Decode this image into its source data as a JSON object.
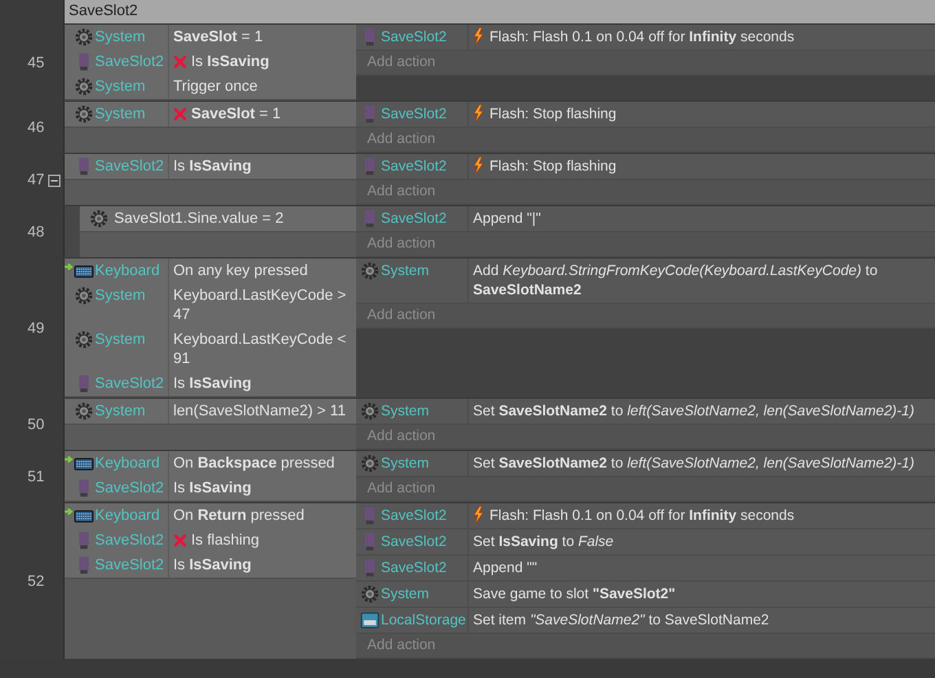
{
  "group": {
    "title": "SaveSlot2"
  },
  "events": [
    {
      "line": "45",
      "conditions": [
        {
          "object": "System",
          "kind": "system",
          "trigger": false,
          "inverted": false,
          "text": "**SaveSlot** = 1"
        },
        {
          "object": "SaveSlot2",
          "kind": "sprite",
          "trigger": false,
          "inverted": true,
          "text": "Is **IsSaving**"
        },
        {
          "object": "System",
          "kind": "system",
          "trigger": false,
          "inverted": false,
          "text": "Trigger once"
        }
      ],
      "actions": [
        {
          "object": "SaveSlot2",
          "kind": "sprite",
          "behavior": true,
          "text": "Flash: Flash 0.1 on 0.04 off for **Infinity** seconds"
        }
      ],
      "add_action": "Add action"
    },
    {
      "line": "46",
      "conditions": [
        {
          "object": "System",
          "kind": "system",
          "trigger": false,
          "inverted": true,
          "text": "**SaveSlot** = 1"
        }
      ],
      "actions": [
        {
          "object": "SaveSlot2",
          "kind": "sprite",
          "behavior": true,
          "text": "Flash: Stop flashing"
        }
      ],
      "add_action": "Add action"
    },
    {
      "line": "47",
      "expanded": true,
      "conditions": [
        {
          "object": "SaveSlot2",
          "kind": "sprite",
          "trigger": false,
          "inverted": false,
          "text": "Is **IsSaving**"
        }
      ],
      "actions": [
        {
          "object": "SaveSlot2",
          "kind": "sprite",
          "behavior": true,
          "text": "Flash: Stop flashing"
        }
      ],
      "add_action": "Add action",
      "children": [
        {
          "line": "48",
          "conditions": [
            {
              "kind": "system",
              "trigger": false,
              "inverted": false,
              "text": "SaveSlot1.Sine.value = 2"
            }
          ],
          "actions": [
            {
              "object": "SaveSlot2",
              "kind": "sprite",
              "behavior": false,
              "text": "Append \"|\""
            }
          ],
          "add_action": "Add action"
        }
      ]
    },
    {
      "line": "49",
      "conditions": [
        {
          "object": "Keyboard",
          "kind": "keyboard",
          "trigger": true,
          "inverted": false,
          "text": "On any key pressed"
        },
        {
          "object": "System",
          "kind": "system",
          "trigger": false,
          "inverted": false,
          "text": "Keyboard.LastKeyCode > 47"
        },
        {
          "object": "System",
          "kind": "system",
          "trigger": false,
          "inverted": false,
          "text": "Keyboard.LastKeyCode < 91"
        },
        {
          "object": "SaveSlot2",
          "kind": "sprite",
          "trigger": false,
          "inverted": false,
          "text": "Is **IsSaving**"
        }
      ],
      "actions": [
        {
          "object": "System",
          "kind": "system",
          "behavior": false,
          "text": "Add *Keyboard.StringFromKeyCode(Keyboard.LastKeyCode)*  to **SaveSlotName2**"
        }
      ],
      "add_action": "Add action"
    },
    {
      "line": "50",
      "conditions": [
        {
          "object": "System",
          "kind": "system",
          "trigger": false,
          "inverted": false,
          "text": "len(SaveSlotName2) > 11"
        }
      ],
      "actions": [
        {
          "object": "System",
          "kind": "system",
          "behavior": false,
          "text": "Set **SaveSlotName2** to *left(SaveSlotName2, len(SaveSlotName2)-1)*"
        }
      ],
      "add_action": "Add action"
    },
    {
      "line": "51",
      "conditions": [
        {
          "object": "Keyboard",
          "kind": "keyboard",
          "trigger": true,
          "inverted": false,
          "text": "On **Backspace** pressed"
        },
        {
          "object": "SaveSlot2",
          "kind": "sprite",
          "trigger": false,
          "inverted": false,
          "text": "Is **IsSaving**"
        }
      ],
      "actions": [
        {
          "object": "System",
          "kind": "system",
          "behavior": false,
          "text": "Set **SaveSlotName2** to *left(SaveSlotName2, len(SaveSlotName2)-1)*"
        }
      ],
      "add_action": "Add action"
    },
    {
      "line": "52",
      "conditions": [
        {
          "object": "Keyboard",
          "kind": "keyboard",
          "trigger": true,
          "inverted": false,
          "text": "On **Return** pressed"
        },
        {
          "object": "SaveSlot2",
          "kind": "sprite",
          "trigger": false,
          "inverted": true,
          "text": "Is flashing"
        },
        {
          "object": "SaveSlot2",
          "kind": "sprite",
          "trigger": false,
          "inverted": false,
          "text": "Is **IsSaving**"
        }
      ],
      "actions": [
        {
          "object": "SaveSlot2",
          "kind": "sprite",
          "behavior": true,
          "text": "Flash: Flash 0.1 on 0.04 off for **Infinity** seconds"
        },
        {
          "object": "SaveSlot2",
          "kind": "sprite",
          "behavior": false,
          "text": "Set **IsSaving** to *False*"
        },
        {
          "object": "SaveSlot2",
          "kind": "sprite",
          "behavior": false,
          "text": "Append \"\""
        },
        {
          "object": "System",
          "kind": "system",
          "behavior": false,
          "text": "Save game to slot **\"SaveSlot2\"**"
        },
        {
          "object": "LocalStorage",
          "kind": "storage",
          "behavior": false,
          "text": "Set item *\"SaveSlotName2\"* to SaveSlotName2"
        }
      ],
      "add_action": "Add action"
    }
  ]
}
